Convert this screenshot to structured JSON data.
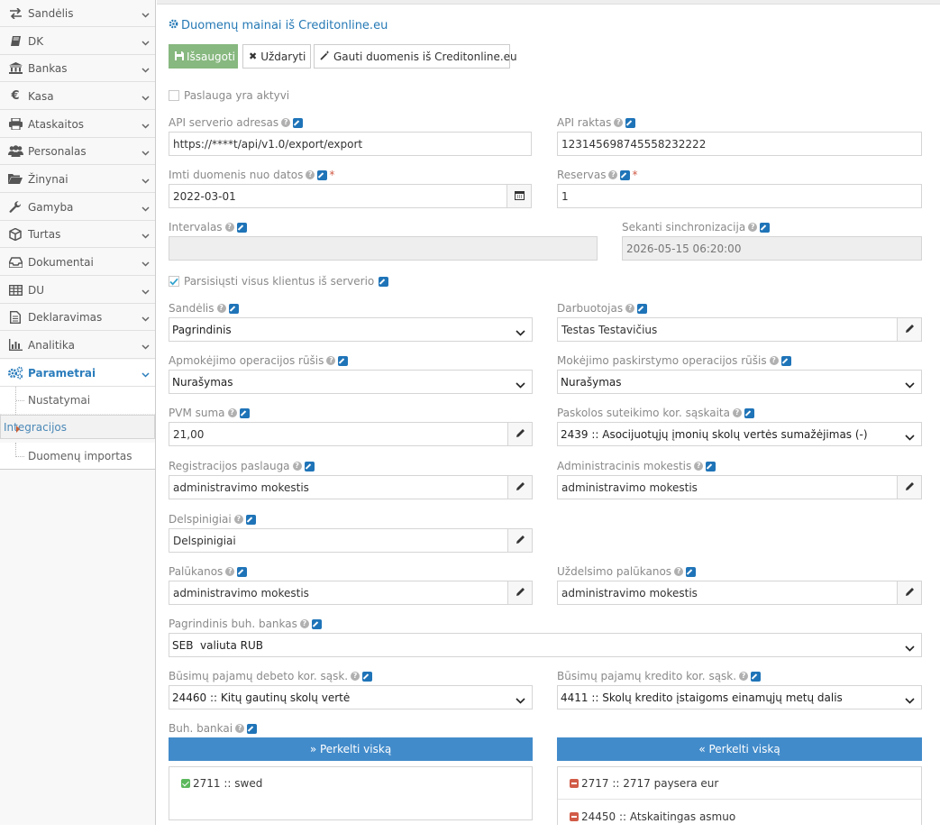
{
  "sidebar": {
    "items": [
      {
        "label": "Sandėlis",
        "icon": "exchange-icon"
      },
      {
        "label": "DK",
        "icon": "book-icon"
      },
      {
        "label": "Bankas",
        "icon": "bank-icon"
      },
      {
        "label": "Kasa",
        "icon": "euro-icon"
      },
      {
        "label": "Ataskaitos",
        "icon": "print-icon"
      },
      {
        "label": "Personalas",
        "icon": "users-icon"
      },
      {
        "label": "Žinynai",
        "icon": "folder-open-icon"
      },
      {
        "label": "Gamyba",
        "icon": "wrench-icon"
      },
      {
        "label": "Turtas",
        "icon": "cube-icon"
      },
      {
        "label": "Dokumentai",
        "icon": "inbox-icon"
      },
      {
        "label": "DU",
        "icon": "table-icon"
      },
      {
        "label": "Deklaravimas",
        "icon": "file-text-icon"
      },
      {
        "label": "Analitika",
        "icon": "bar-chart-icon"
      },
      {
        "label": "Parametrai",
        "icon": "cogs-icon"
      }
    ],
    "subitems": [
      {
        "label": "Nustatymai"
      },
      {
        "label": "Integracijos"
      },
      {
        "label": "Duomenų importas"
      }
    ]
  },
  "page": {
    "title": "Duomenų mainai iš Creditonline.eu",
    "btn_save": "Išsaugoti",
    "btn_close": "Uždaryti",
    "btn_fetch": "Gauti duomenis iš Creditonline.eu"
  },
  "form": {
    "service_active_label": "Paslauga yra aktyvi",
    "api_address_label": "API serverio adresas",
    "api_address_value": "https://****t/api/v1.0/export/export",
    "api_key_label": "API raktas",
    "api_key_value": "123145698745558232222",
    "date_from_label": "Imti duomenis nuo datos",
    "date_from_value": "2022-03-01",
    "reserve_label": "Reservas",
    "reserve_value": "1",
    "interval_label": "Intervalas",
    "interval_value": "",
    "next_sync_label": "Sekanti sinchronizacija",
    "next_sync_value": "2026-05-15 06:20:00",
    "download_clients_label": "Parsisiųsti visus klientus iš serverio",
    "warehouse_label": "Sandėlis",
    "warehouse_value": "Pagrindinis",
    "employee_label": "Darbuotojas",
    "employee_value": "Testas Testavičius",
    "payment_op_label": "Apmokėjimo operacijos rūšis",
    "payment_op_value": "Nurašymas",
    "payment_dist_label": "Mokėjimo paskirstymo operacijos rūšis",
    "payment_dist_value": "Nurašymas",
    "vat_label": "PVM suma",
    "vat_value": "21,00",
    "loan_account_label": "Paskolos suteikimo kor. sąskaita",
    "loan_account_value": "2439 :: Asocijuotųjų įmonių skolų vertės sumažėjimas (-)",
    "registration_label": "Registracijos paslauga",
    "registration_value": "administravimo mokestis",
    "admin_fee_label": "Administracinis mokestis",
    "admin_fee_value": "administravimo mokestis",
    "penalty_label": "Delspinigiai",
    "penalty_value": "Delspinigiai",
    "interest_label": "Palūkanos",
    "interest_value": "administravimo mokestis",
    "late_interest_label": "Uždelsimo palūkanos",
    "late_interest_value": "administravimo mokestis",
    "main_bank_label": "Pagrindinis buh. bankas",
    "main_bank_value": "SEB  valiuta RUB",
    "future_debit_label": "Būsimų pajamų debeto kor. sąsk.",
    "future_debit_value": "24460 :: Kitų gautinų skolų vertė",
    "future_credit_label": "Būsimų pajamų kredito kor. sąsk.",
    "future_credit_value": "4411 :: Skolų kredito įstaigoms einamųjų metų dalis",
    "banks_label": "Buh. bankai",
    "move_all_right": "» Perkelti viską",
    "move_all_left": "« Perkelti viską",
    "selected_banks": [
      "2711 :: swed"
    ],
    "available_banks": [
      "2717 :: 2717 paysera eur",
      "24450 :: Atskaitingas asmuo"
    ]
  }
}
